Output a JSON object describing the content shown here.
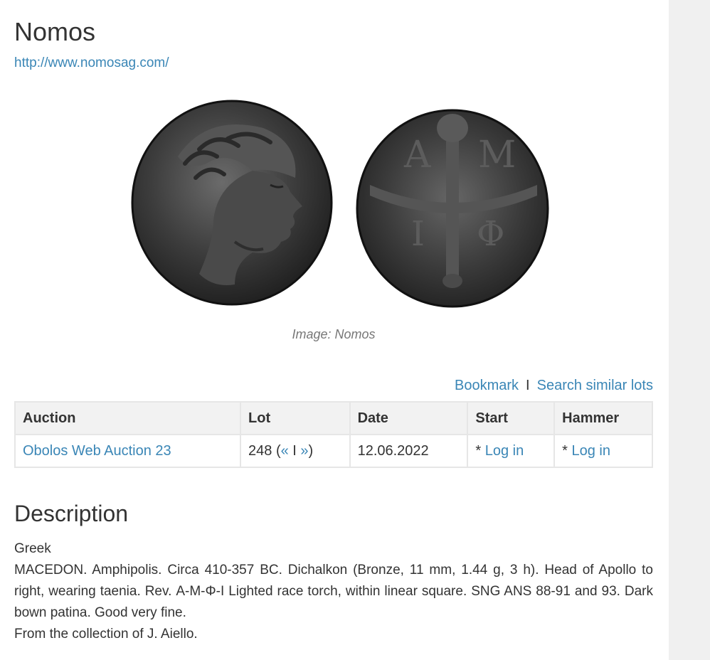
{
  "header": {
    "title": "Nomos",
    "url": "http://www.nomosag.com/"
  },
  "image": {
    "caption": "Image: Nomos",
    "obverse_icon": "coin-obverse-apollo-head",
    "reverse_icon": "coin-reverse-torch",
    "reverse_letters": [
      "Α",
      "Μ",
      "Ι",
      "Φ"
    ]
  },
  "actions": {
    "bookmark": "Bookmark",
    "separator": "I",
    "search_similar": "Search similar lots"
  },
  "table": {
    "headers": [
      "Auction",
      "Lot",
      "Date",
      "Start",
      "Hammer"
    ],
    "row": {
      "auction": "Obolos Web Auction 23",
      "lot_number": "248",
      "lot_open": " (",
      "prev": "«",
      "nav_sep": " I ",
      "next": "»",
      "lot_close": ")",
      "date": "12.06.2022",
      "start_prefix": "* ",
      "start_link": "Log in",
      "hammer_prefix": "* ",
      "hammer_link": "Log in"
    }
  },
  "description": {
    "heading": "Description",
    "category": "Greek",
    "text": "MACEDON. Amphipolis. Circa 410-357 BC. Dichalkon (Bronze, 11 mm, 1.44 g, 3 h). Head of Apollo to right, wearing taenia. Rev. Α-Μ-Φ-Ι Lighted race torch, within linear square. SNG ANS 88-91 and 93. Dark bown patina. Good very fine.",
    "provenance": "From the collection of J. Aiello."
  },
  "colors": {
    "link": "#3a86b6",
    "text": "#333333",
    "table_header_bg": "#f2f2f2",
    "sidebar_bg": "#f0f0f0"
  }
}
